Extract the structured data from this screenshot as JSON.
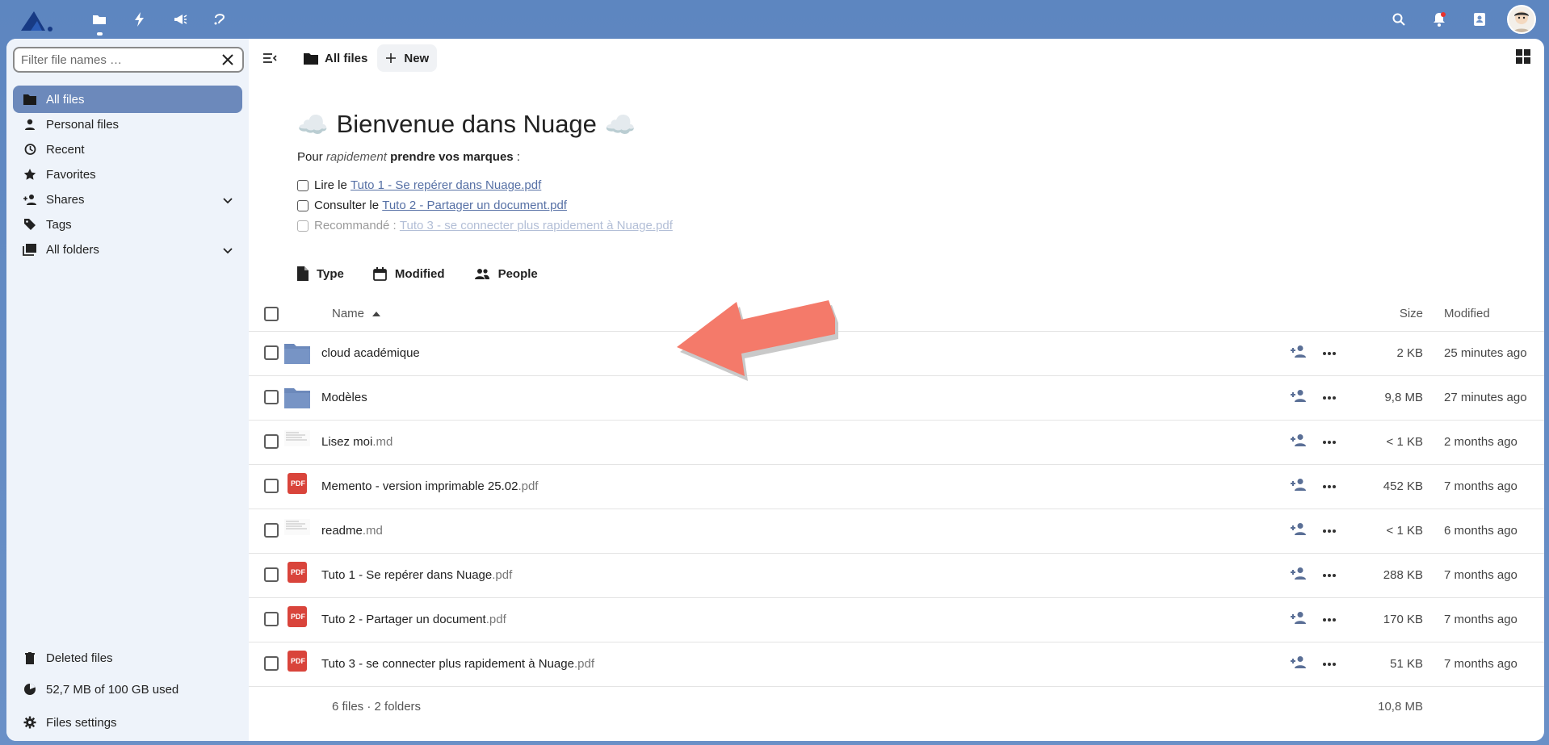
{
  "topbar": {
    "apps": [
      "files-icon",
      "activity-icon",
      "announcements-icon",
      "flow-icon"
    ],
    "right": [
      "search-icon",
      "notifications-icon",
      "contacts-icon"
    ]
  },
  "sidebar": {
    "filter_placeholder": "Filter file names …",
    "items": [
      {
        "label": "All files",
        "icon": "folder-icon",
        "active": true
      },
      {
        "label": "Personal files",
        "icon": "person-icon"
      },
      {
        "label": "Recent",
        "icon": "history-icon"
      },
      {
        "label": "Favorites",
        "icon": "star-icon"
      },
      {
        "label": "Shares",
        "icon": "share-icon",
        "expandable": true
      },
      {
        "label": "Tags",
        "icon": "tag-icon"
      },
      {
        "label": "All folders",
        "icon": "folders-icon",
        "expandable": true
      }
    ],
    "deleted": "Deleted files",
    "storage": "52,7 MB of 100 GB used",
    "settings": "Files settings"
  },
  "breadcrumb": {
    "current": "All files",
    "new_label": "New"
  },
  "welcome": {
    "title": "Bienvenue dans Nuage",
    "sub_prefix": "Pour",
    "sub_italic": "rapidement",
    "sub_bold": "prendre vos marques",
    "sub_suffix": " :",
    "todos": [
      {
        "prefix": "Lire le",
        "link": "Tuto 1 - Se repérer dans Nuage.pdf"
      },
      {
        "prefix": "Consulter le",
        "link": "Tuto 2 - Partager un document.pdf"
      },
      {
        "prefix": "Recommandé :",
        "link": "Tuto 3 - se connecter plus rapidement à Nuage.pdf"
      }
    ]
  },
  "filters": {
    "type": "Type",
    "modified": "Modified",
    "people": "People"
  },
  "table": {
    "col_name": "Name",
    "col_size": "Size",
    "col_modified": "Modified",
    "rows": [
      {
        "name": "cloud académique",
        "ext": "",
        "kind": "folder",
        "size": "2 KB",
        "modified": "25 minutes ago"
      },
      {
        "name": "Modèles",
        "ext": "",
        "kind": "folder",
        "size": "9,8 MB",
        "modified": "27 minutes ago"
      },
      {
        "name": "Lisez moi",
        "ext": ".md",
        "kind": "text",
        "size": "< 1 KB",
        "modified": "2 months ago"
      },
      {
        "name": "Memento - version imprimable 25.02",
        "ext": ".pdf",
        "kind": "pdf",
        "size": "452 KB",
        "modified": "7 months ago"
      },
      {
        "name": "readme",
        "ext": ".md",
        "kind": "text",
        "size": "< 1 KB",
        "modified": "6 months ago"
      },
      {
        "name": "Tuto 1 - Se repérer dans Nuage",
        "ext": ".pdf",
        "kind": "pdf",
        "size": "288 KB",
        "modified": "7 months ago"
      },
      {
        "name": "Tuto 2 - Partager un document",
        "ext": ".pdf",
        "kind": "pdf",
        "size": "170 KB",
        "modified": "7 months ago"
      },
      {
        "name": "Tuto 3 - se connecter plus rapidement à Nuage",
        "ext": ".pdf",
        "kind": "pdf",
        "size": "51 KB",
        "modified": "7 months ago"
      }
    ],
    "footer_summary": "6 files · 2 folders",
    "footer_size": "10,8 MB"
  },
  "pdf_badge": "PDF",
  "colors": {
    "accent": "#6c89bb",
    "topbar": "#6a90c7",
    "arrow": "#f47a6a",
    "pdf": "#d9443b"
  }
}
